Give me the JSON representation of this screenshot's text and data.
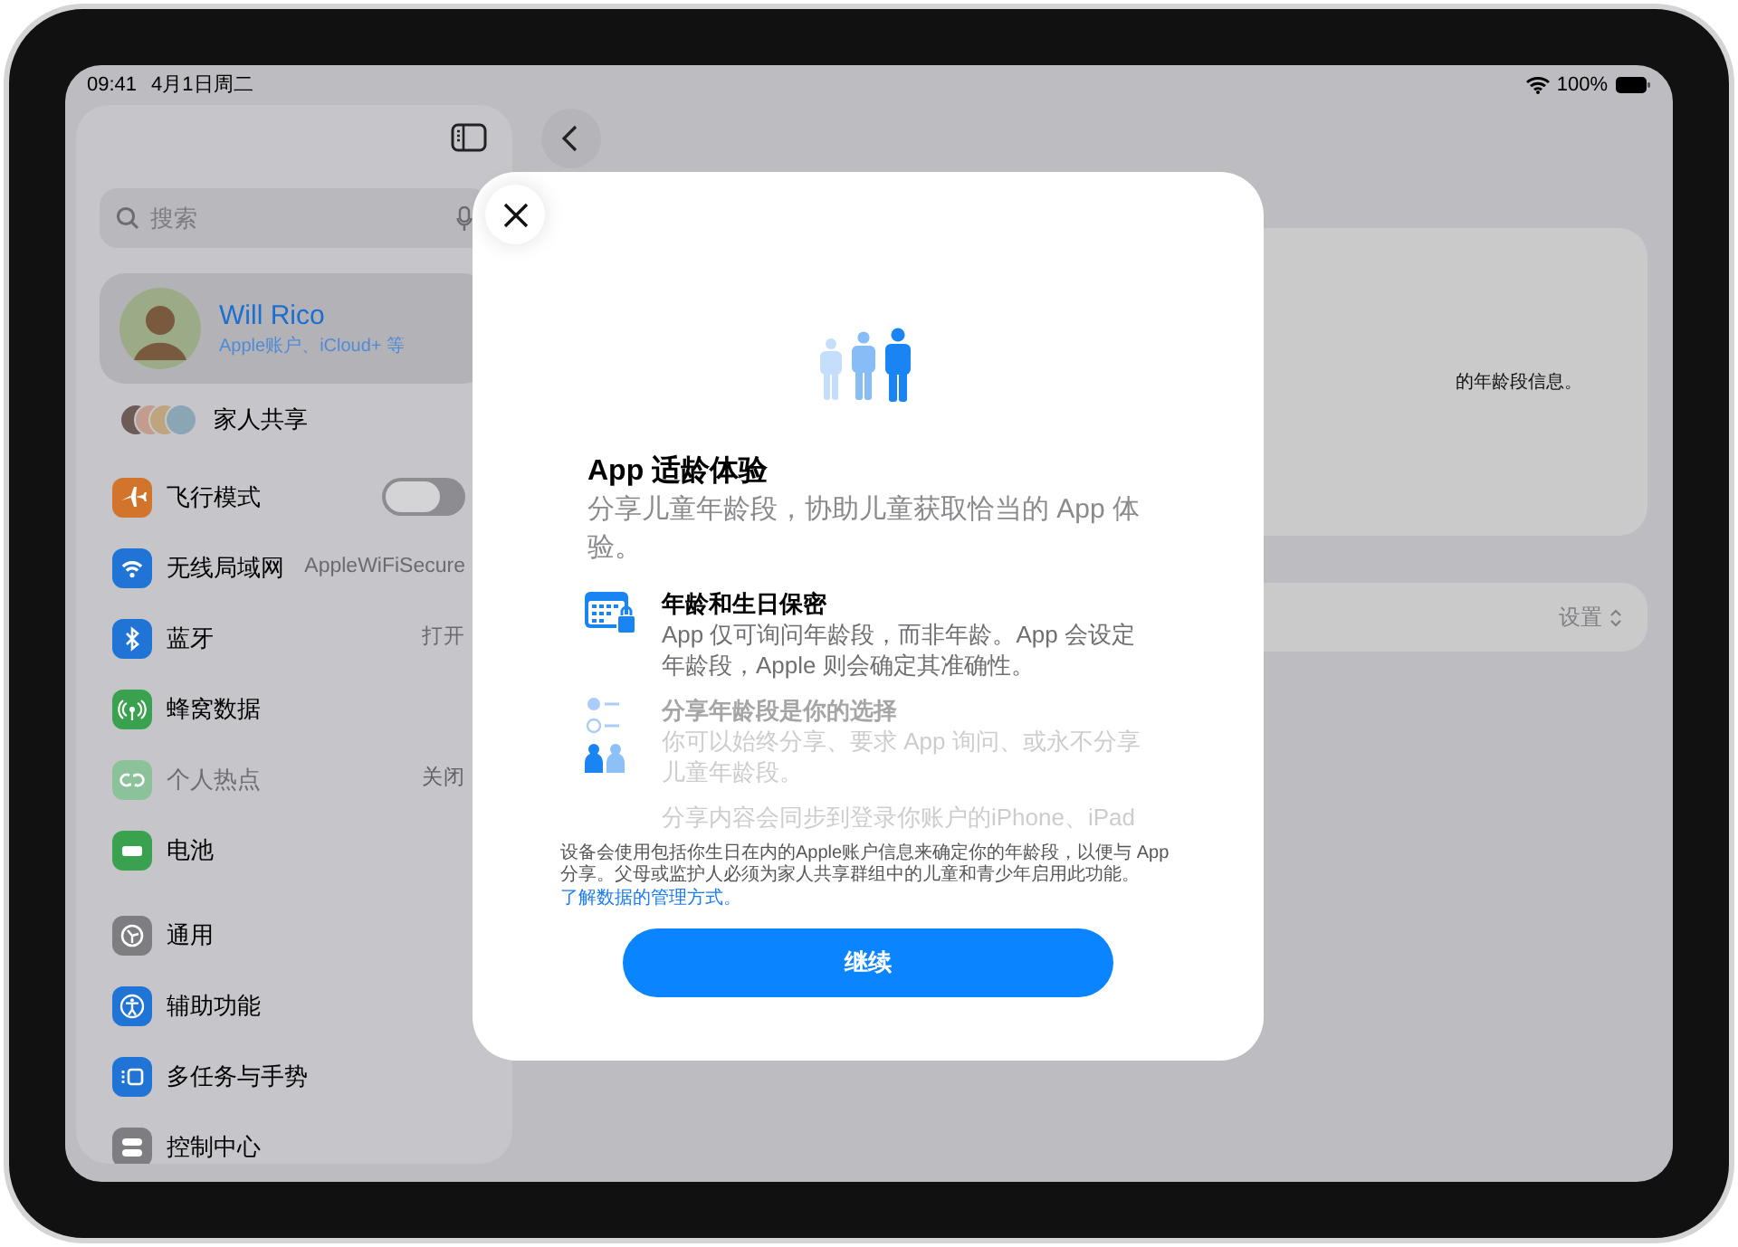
{
  "status_bar": {
    "time": "09:41",
    "date": "4月1日周二",
    "battery": "100%"
  },
  "sidebar": {
    "search": {
      "placeholder": "搜索"
    },
    "account": {
      "name": "Will Rico",
      "subtitle": "Apple账户、iCloud+ 等",
      "selected": true
    },
    "family": {
      "label": "家人共享"
    },
    "groups": [
      [
        {
          "kind": "toggle",
          "label": "飞行模式",
          "color": "#d2742c",
          "on": false,
          "disabled": false
        },
        {
          "kind": "value",
          "label": "无线局域网",
          "value": "AppleWiFiSecure",
          "color": "#1f74d6",
          "disabled": false
        },
        {
          "kind": "value",
          "label": "蓝牙",
          "value": "打开",
          "color": "#1f74d6",
          "disabled": false
        },
        {
          "kind": "link",
          "label": "蜂窝数据",
          "color": "#3aa24f",
          "disabled": false
        },
        {
          "kind": "value",
          "label": "个人热点",
          "value": "关闭",
          "color": "#8cc299",
          "disabled": true
        },
        {
          "kind": "link",
          "label": "电池",
          "color": "#3aa24f",
          "disabled": false
        }
      ],
      [
        {
          "kind": "link",
          "label": "通用",
          "color": "#7d7d82",
          "disabled": false
        },
        {
          "kind": "link",
          "label": "辅助功能",
          "color": "#1f74d6",
          "disabled": false
        },
        {
          "kind": "link",
          "label": "多任务与手势",
          "color": "#1f74d6",
          "disabled": false
        },
        {
          "kind": "link",
          "label": "控制中心",
          "color": "#7d7d82",
          "disabled": false
        }
      ]
    ]
  },
  "detail": {
    "card_text": "的年龄段信息。",
    "setting_value": "设置"
  },
  "modal": {
    "title": "App 适龄体验",
    "subtitle": "分享儿童年龄段，协助儿童获取恰当的 App 体验。",
    "features": [
      {
        "title": "年龄和生日保密",
        "body": "App 仅可询问年龄段，而非年龄。App 会设定年龄段，Apple 则会确定其准确性。",
        "faded": false
      },
      {
        "title": "分享年龄段是你的选择",
        "body": "你可以始终分享、要求 App 询问、或永不分享儿童年龄段。",
        "faded": true
      },
      {
        "body": "分享内容会同步到登录你账户的iPhone、iPad",
        "faded": true
      }
    ],
    "footnote": "设备会使用包括你生日在内的Apple账户信息来确定你的年龄段，以便与 App 分享。父母或监护人必须为家人共享群组中的儿童和青少年启用此功能。",
    "link": "了解数据的管理方式。",
    "button": "继续"
  }
}
